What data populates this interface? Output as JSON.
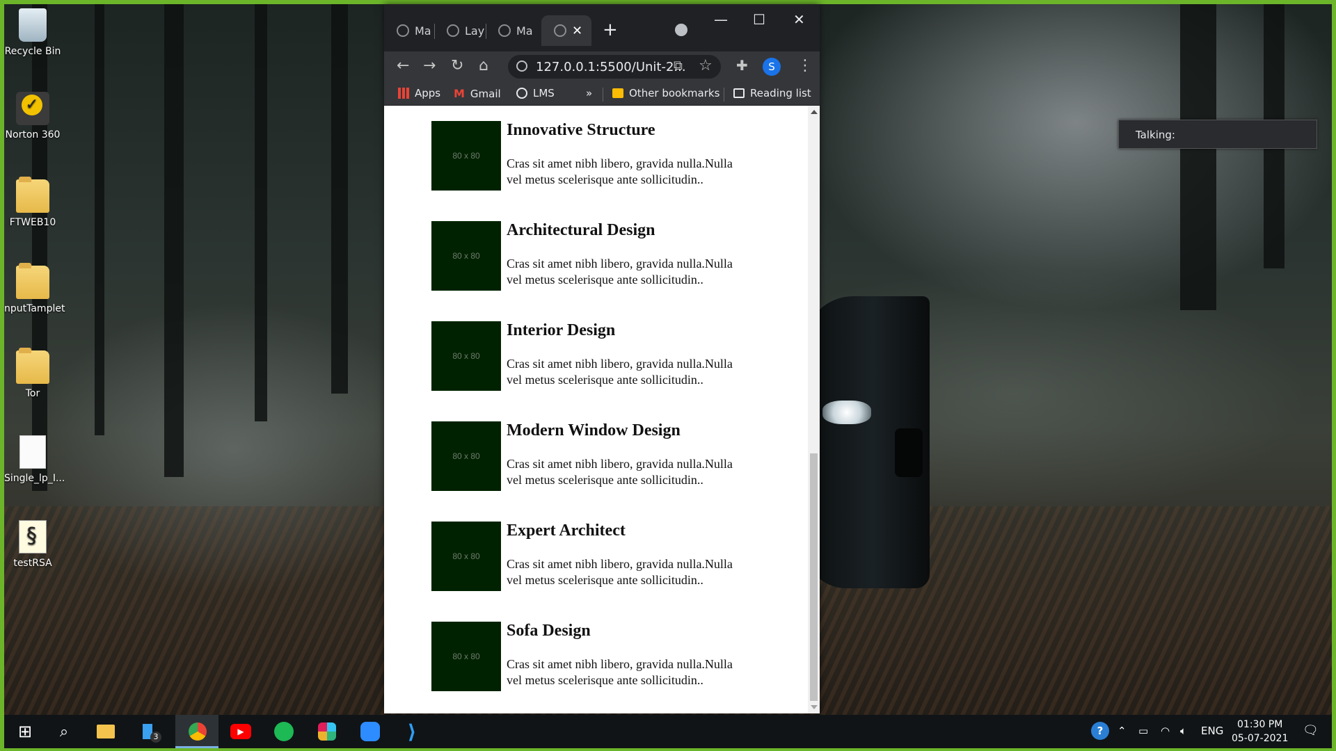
{
  "desktop": {
    "icons": [
      {
        "label": "Recycle Bin",
        "icon": "recycle-bin-icon"
      },
      {
        "label": "Norton 360",
        "icon": "norton-icon"
      },
      {
        "label": "FTWEB10",
        "icon": "folder-icon"
      },
      {
        "label": "nputTamplet",
        "icon": "folder-icon"
      },
      {
        "label": "Tor",
        "icon": "folder-icon"
      },
      {
        "label": "Single_lp_I...",
        "icon": "file-icon"
      },
      {
        "label": "testRSA",
        "icon": "script-icon"
      }
    ]
  },
  "browser": {
    "tabs": [
      {
        "label": "Ma"
      },
      {
        "label": "Lay"
      },
      {
        "label": "Ma"
      },
      {
        "label": ""
      }
    ],
    "address": "127.0.0.1:5500/Unit-2...",
    "profile_initial": "S",
    "bookmarks": {
      "apps": "Apps",
      "gmail": "Gmail",
      "lms": "LMS",
      "overflow": "»",
      "other": "Other bookmarks",
      "reading": "Reading list"
    }
  },
  "page": {
    "placeholder_text": "80 x 80",
    "services": [
      {
        "title": "Innovative Structure",
        "text": "Cras sit amet nibh libero, gravida nulla.Nulla vel metus scelerisque ante sollicitudin.."
      },
      {
        "title": "Architectural Design",
        "text": "Cras sit amet nibh libero, gravida nulla.Nulla vel metus scelerisque ante sollicitudin.."
      },
      {
        "title": "Interior Design",
        "text": "Cras sit amet nibh libero, gravida nulla.Nulla vel metus scelerisque ante sollicitudin.."
      },
      {
        "title": "Modern Window Design",
        "text": "Cras sit amet nibh libero, gravida nulla.Nulla vel metus scelerisque ante sollicitudin.."
      },
      {
        "title": "Expert Architect",
        "text": "Cras sit amet nibh libero, gravida nulla.Nulla vel metus scelerisque ante sollicitudin.."
      },
      {
        "title": "Sofa Design",
        "text": "Cras sit amet nibh libero, gravida nulla.Nulla vel metus scelerisque ante sollicitudin.."
      }
    ]
  },
  "overlay": {
    "talking": "Talking:"
  },
  "taskbar": {
    "badge_count": "3",
    "language": "ENG",
    "time": "01:30 PM",
    "date": "05-07-2021"
  },
  "colors": {
    "thumb_bg": "#002200",
    "frame_green": "#6cb52a",
    "chrome_dark": "#202124"
  }
}
